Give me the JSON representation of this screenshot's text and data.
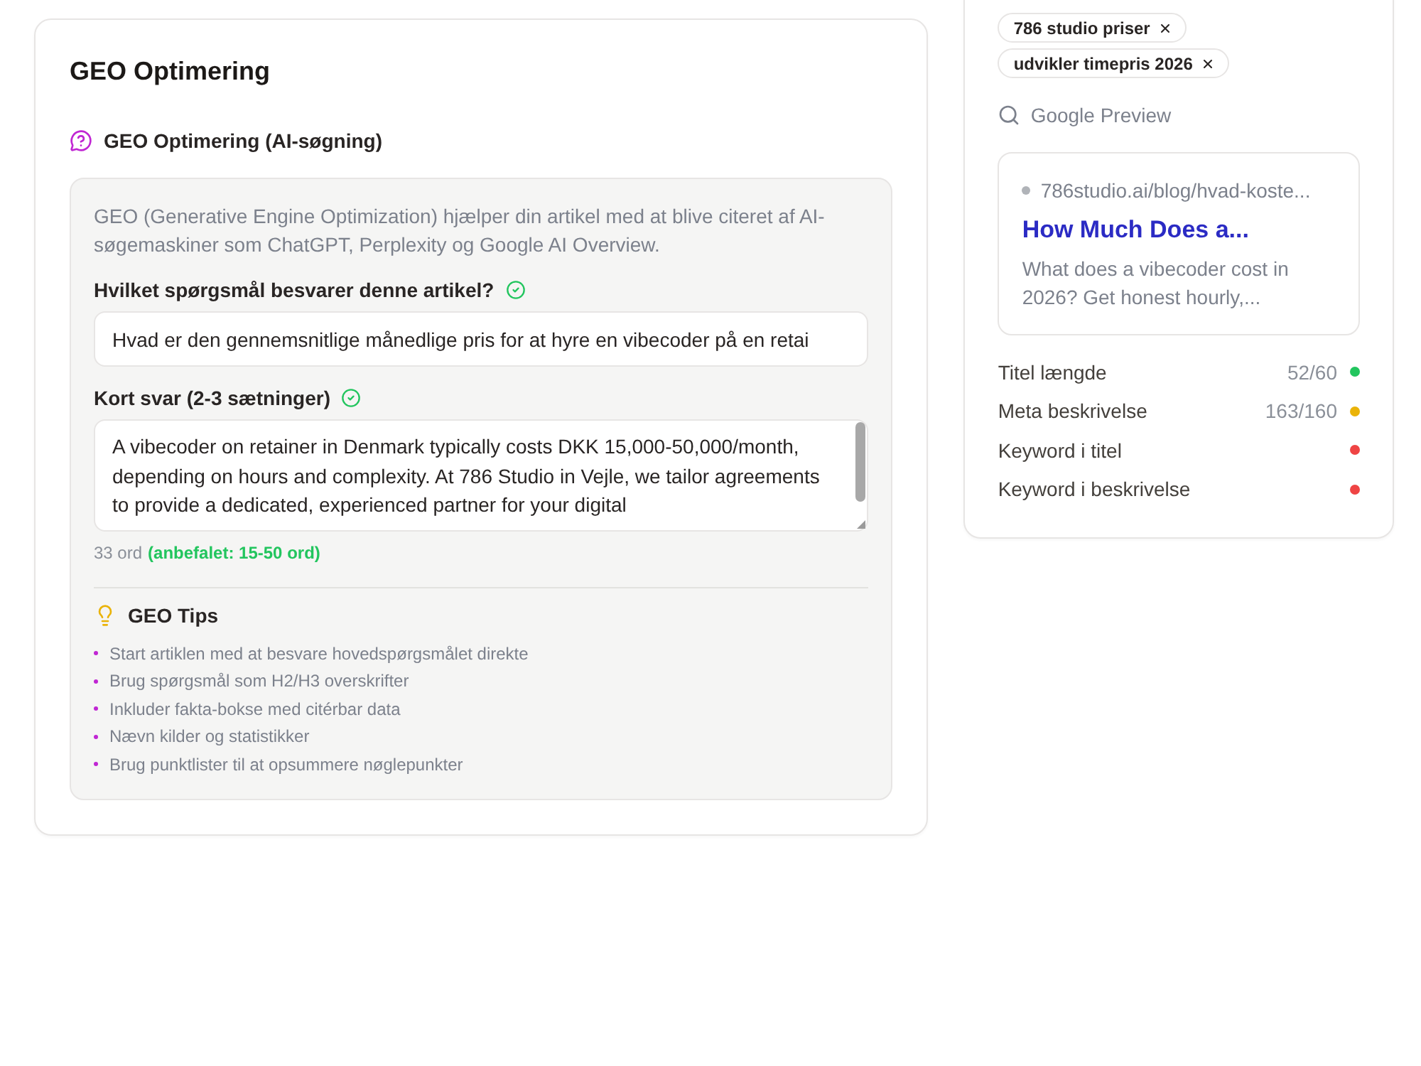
{
  "card": {
    "title": "GEO Optimering"
  },
  "geo_section": {
    "heading": "GEO Optimering (AI-søgning)",
    "description": "GEO (Generative Engine Optimization) hjælper din artikel med at blive citeret af AI-søgemaskiner som ChatGPT, Perplexity og Google AI Overview.",
    "question": {
      "label": "Hvilket spørgsmål besvarer denne artikel?",
      "valid": true,
      "value": "Hvad er den gennemsnitlige månedlige pris for at hyre en vibecoder på en retai"
    },
    "answer": {
      "label": "Kort svar (2-3 sætninger)",
      "valid": true,
      "value": "A vibecoder on retainer in Denmark typically costs DKK 15,000-50,000/month, depending on hours and complexity. At 786 Studio in Vejle, we tailor agreements to provide a dedicated, experienced partner for your digital",
      "word_count": "33 ord",
      "recommendation": "(anbefalet: 15-50 ord)"
    },
    "tips": {
      "heading": "GEO Tips",
      "items": [
        "Start artiklen med at besvare hovedspørgsmålet direkte",
        "Brug spørgsmål som H2/H3 overskrifter",
        "Inkluder fakta-bokse med citérbar data",
        "Nævn kilder og statistikker",
        "Brug punktlister til at opsummere nøglepunkter"
      ]
    }
  },
  "sidebar": {
    "keywords": [
      {
        "label": "786 studio priser"
      },
      {
        "label": "udvikler timepris 2026"
      }
    ],
    "preview_heading": "Google Preview",
    "preview": {
      "url": "786studio.ai/blog/hvad-koste...",
      "title": "How Much Does a...",
      "description": "What does a vibecoder cost in 2026? Get honest hourly,..."
    },
    "metrics": [
      {
        "label": "Titel længde",
        "value": "52/60",
        "color": "#22c55e"
      },
      {
        "label": "Meta beskrivelse",
        "value": "163/160",
        "color": "#eab308"
      },
      {
        "label": "Keyword i titel",
        "color": "#ef4444"
      },
      {
        "label": "Keyword i beskrivelse",
        "color": "#ef4444"
      }
    ]
  }
}
